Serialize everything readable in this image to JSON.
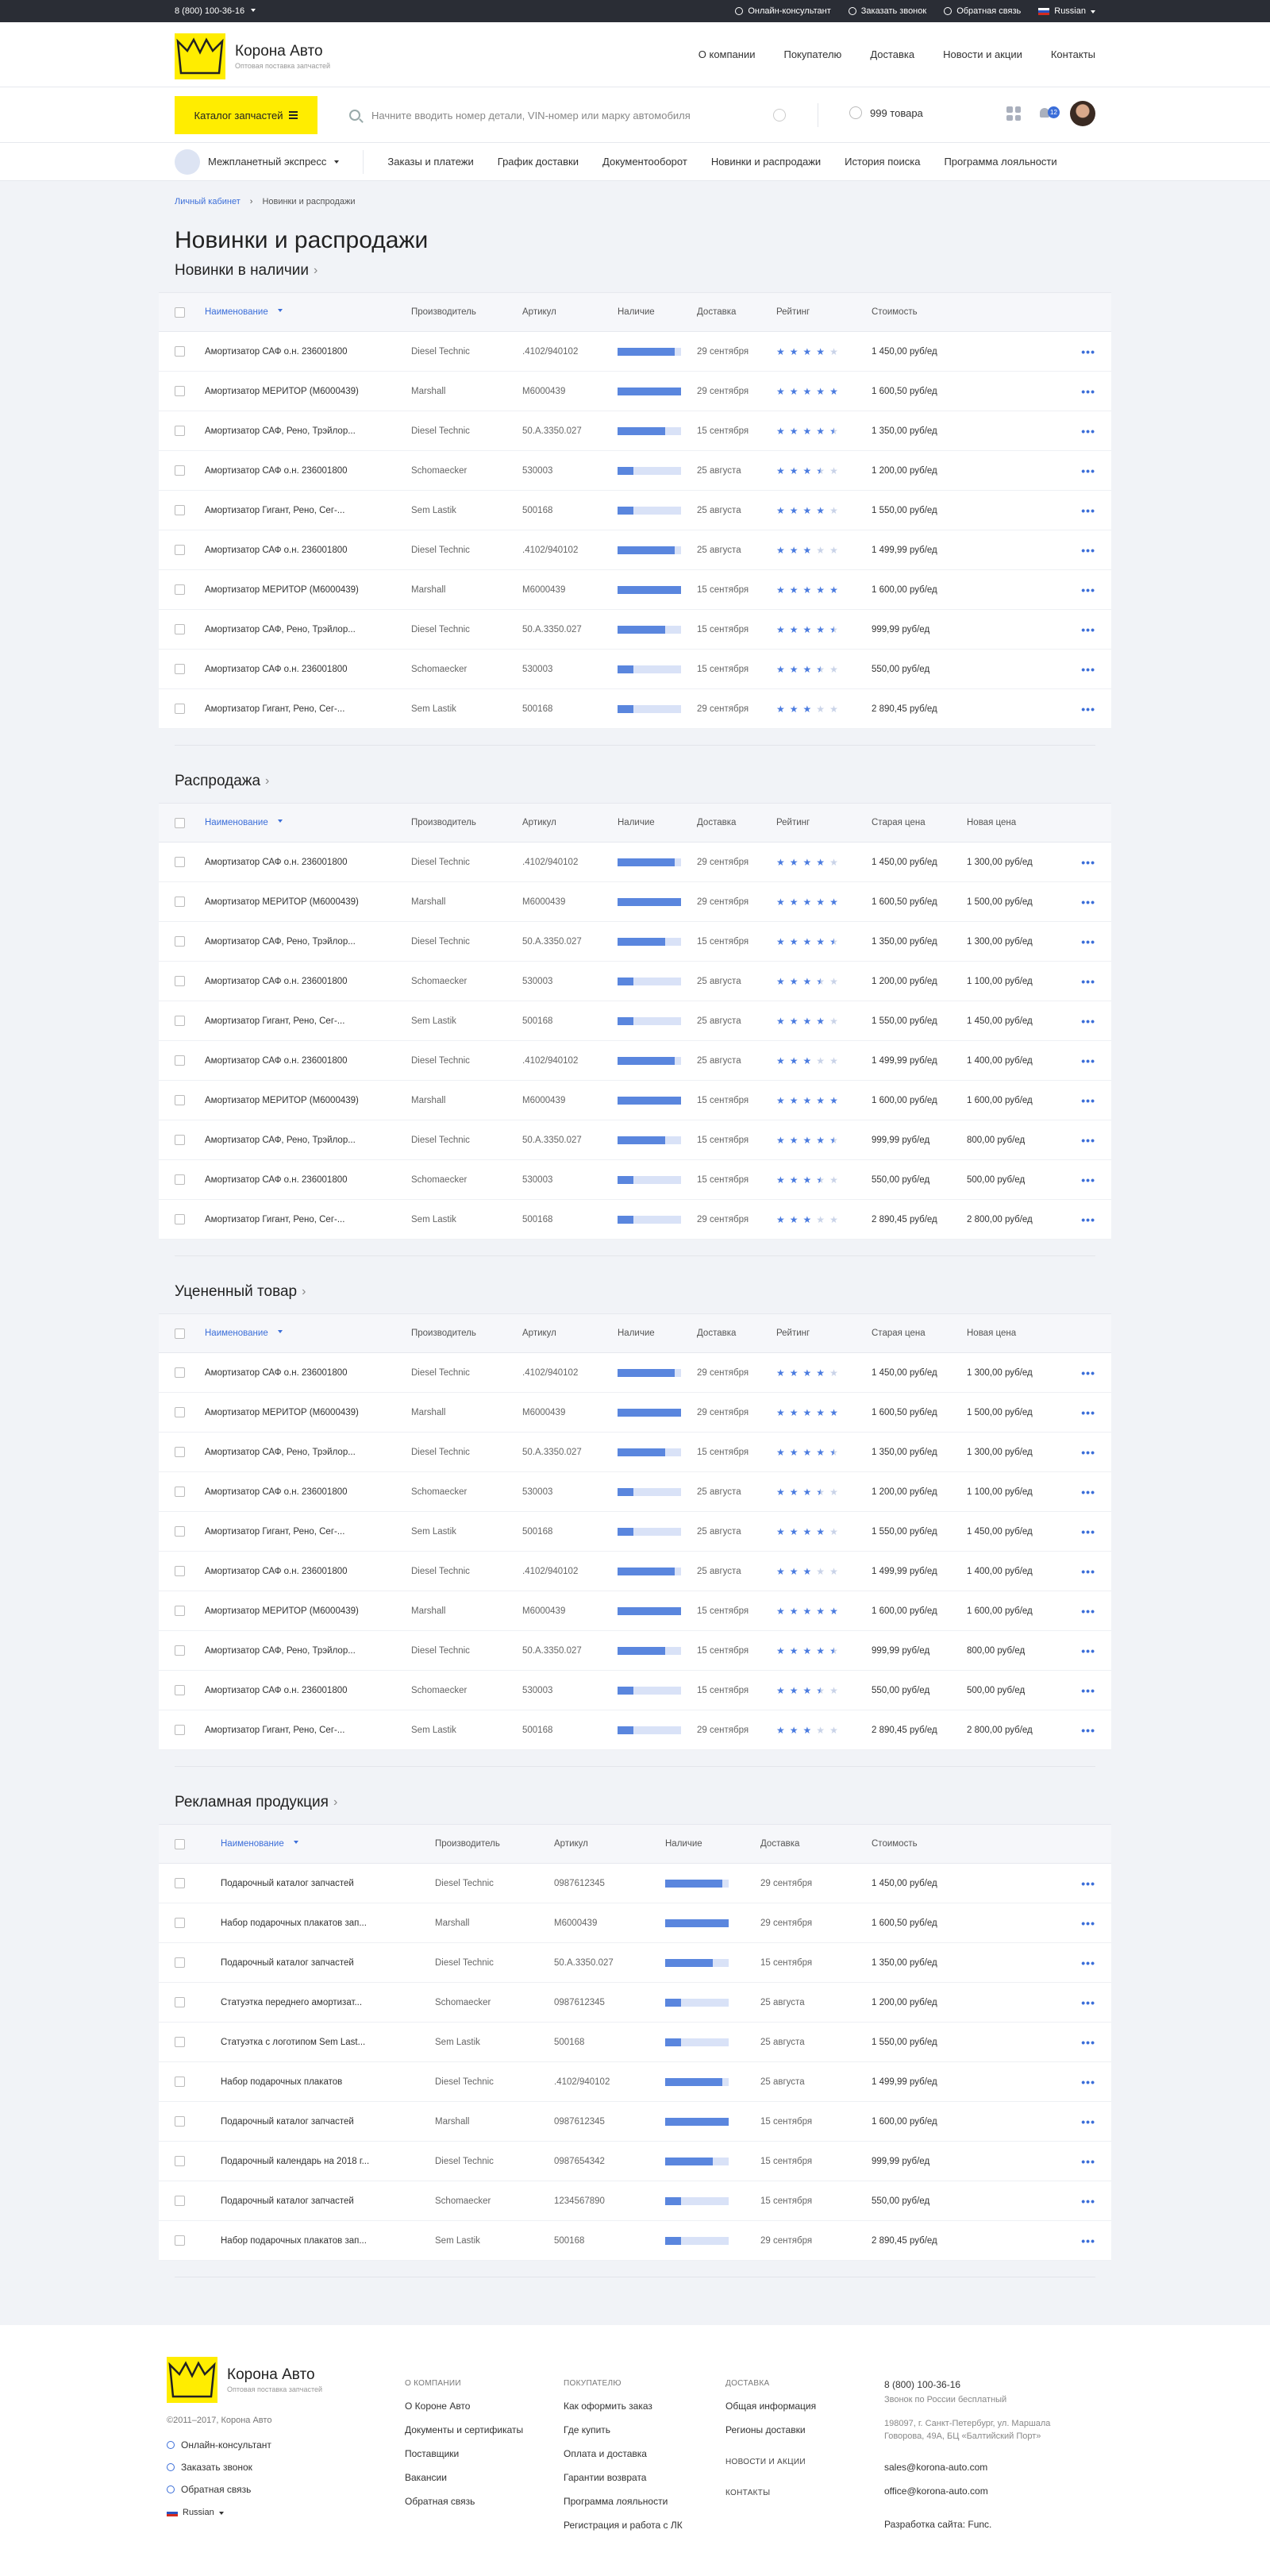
{
  "topbar": {
    "phone": "8 (800) 100-36-16",
    "links": [
      "Онлайн-консультант",
      "Заказать звонок",
      "Обратная связь"
    ],
    "lang": "Russian"
  },
  "header": {
    "logo_title": "Корона Авто",
    "logo_sub": "Оптовая поставка запчастей",
    "nav": [
      "О компании",
      "Покупателю",
      "Доставка",
      "Новости и акции",
      "Контакты"
    ]
  },
  "searchbar": {
    "catalog_btn": "Каталог запчастей",
    "placeholder": "Начните вводить номер детали, VIN-номер или марку автомобиля",
    "cart": "999 товара",
    "notifications": "12"
  },
  "subnav": {
    "items": [
      "Межпланетный экспресс",
      "Заказы и платежи",
      "График доставки",
      "Документооборот",
      "Новинки и распродажи",
      "История поиска",
      "Программа лояльности"
    ]
  },
  "breadcrumbs": [
    "Личный кабинет",
    "Новинки и распродажи"
  ],
  "page_title": "Новинки и распродажи",
  "sections": [
    {
      "title": "Новинки в наличии",
      "type": "rating",
      "cols": [
        "Наименование",
        "Производитель",
        "Артикул",
        "Наличие",
        "Доставка",
        "Рейтинг",
        "Стоимость"
      ],
      "rows": [
        [
          "Амортизатор САФ о.н. 236001800",
          "Diesel Technic",
          ".4102/940102",
          0.9,
          "29 сентября",
          4,
          "1 450,00 руб/ед"
        ],
        [
          "Амортизатор МЕРИТОР (M6000439)",
          "Marshall",
          "M6000439",
          1,
          "29 сентября",
          5,
          "1 600,50 руб/ед"
        ],
        [
          "Амортизатор САФ, Рено, Трэйлор...",
          "Diesel Technic",
          "50.A.3350.027",
          0.75,
          "15 сентября",
          4.5,
          "1 350,00 руб/ед"
        ],
        [
          "Амортизатор САФ о.н. 236001800",
          "Schomaecker",
          "530003",
          0.25,
          "25 августа",
          3.5,
          "1 200,00 руб/ед"
        ],
        [
          "Амортизатор Гигант, Рено, Сег-...",
          "Sem Lastik",
          "500168",
          0.25,
          "25 августа",
          4,
          "1 550,00 руб/ед"
        ],
        [
          "Амортизатор САФ о.н. 236001800",
          "Diesel Technic",
          ".4102/940102",
          0.9,
          "25 августа",
          3,
          "1 499,99 руб/ед"
        ],
        [
          "Амортизатор МЕРИТОР (M6000439)",
          "Marshall",
          "M6000439",
          1,
          "15 сентября",
          5,
          "1 600,00 руб/ед"
        ],
        [
          "Амортизатор САФ, Рено, Трэйлор...",
          "Diesel Technic",
          "50.A.3350.027",
          0.75,
          "15 сентября",
          4.5,
          "999,99 руб/ед"
        ],
        [
          "Амортизатор САФ о.н. 236001800",
          "Schomaecker",
          "530003",
          0.25,
          "15 сентября",
          3.5,
          "550,00 руб/ед"
        ],
        [
          "Амортизатор Гигант, Рено, Сег-...",
          "Sem Lastik",
          "500168",
          0.25,
          "29 сентября",
          3,
          "2 890,45 руб/ед"
        ]
      ]
    },
    {
      "title": "Распродажа",
      "type": "sale",
      "cols": [
        "Наименование",
        "Производитель",
        "Артикул",
        "Наличие",
        "Доставка",
        "Рейтинг",
        "Старая цена",
        "Новая цена"
      ],
      "rows": [
        [
          "Амортизатор САФ о.н. 236001800",
          "Diesel Technic",
          ".4102/940102",
          0.9,
          "29 сентября",
          4,
          "1 450,00 руб/ед",
          "1 300,00 руб/ед"
        ],
        [
          "Амортизатор МЕРИТОР (M6000439)",
          "Marshall",
          "M6000439",
          1,
          "29 сентября",
          5,
          "1 600,50 руб/ед",
          "1 500,00 руб/ед"
        ],
        [
          "Амортизатор САФ, Рено, Трэйлор...",
          "Diesel Technic",
          "50.A.3350.027",
          0.75,
          "15 сентября",
          4.5,
          "1 350,00 руб/ед",
          "1 300,00 руб/ед"
        ],
        [
          "Амортизатор САФ о.н. 236001800",
          "Schomaecker",
          "530003",
          0.25,
          "25 августа",
          3.5,
          "1 200,00 руб/ед",
          "1 100,00 руб/ед"
        ],
        [
          "Амортизатор Гигант, Рено, Сег-...",
          "Sem Lastik",
          "500168",
          0.25,
          "25 августа",
          4,
          "1 550,00 руб/ед",
          "1 450,00 руб/ед"
        ],
        [
          "Амортизатор САФ о.н. 236001800",
          "Diesel Technic",
          ".4102/940102",
          0.9,
          "25 августа",
          3,
          "1 499,99 руб/ед",
          "1 400,00 руб/ед"
        ],
        [
          "Амортизатор МЕРИТОР (M6000439)",
          "Marshall",
          "M6000439",
          1,
          "15 сентября",
          5,
          "1 600,00 руб/ед",
          "1 600,00 руб/ед"
        ],
        [
          "Амортизатор САФ, Рено, Трэйлор...",
          "Diesel Technic",
          "50.A.3350.027",
          0.75,
          "15 сентября",
          4.5,
          "999,99 руб/ед",
          "800,00 руб/ед"
        ],
        [
          "Амортизатор САФ о.н. 236001800",
          "Schomaecker",
          "530003",
          0.25,
          "15 сентября",
          3.5,
          "550,00 руб/ед",
          "500,00 руб/ед"
        ],
        [
          "Амортизатор Гигант, Рено, Сег-...",
          "Sem Lastik",
          "500168",
          0.25,
          "29 сентября",
          3,
          "2 890,45 руб/ед",
          "2 800,00 руб/ед"
        ]
      ]
    },
    {
      "title": "Уцененный товар",
      "type": "sale",
      "cols": [
        "Наименование",
        "Производитель",
        "Артикул",
        "Наличие",
        "Доставка",
        "Рейтинг",
        "Старая цена",
        "Новая цена"
      ],
      "rows": [
        [
          "Амортизатор САФ о.н. 236001800",
          "Diesel Technic",
          ".4102/940102",
          0.9,
          "29 сентября",
          4,
          "1 450,00 руб/ед",
          "1 300,00 руб/ед"
        ],
        [
          "Амортизатор МЕРИТОР (M6000439)",
          "Marshall",
          "M6000439",
          1,
          "29 сентября",
          5,
          "1 600,50 руб/ед",
          "1 500,00 руб/ед"
        ],
        [
          "Амортизатор САФ, Рено, Трэйлор...",
          "Diesel Technic",
          "50.A.3350.027",
          0.75,
          "15 сентября",
          4.5,
          "1 350,00 руб/ед",
          "1 300,00 руб/ед"
        ],
        [
          "Амортизатор САФ о.н. 236001800",
          "Schomaecker",
          "530003",
          0.25,
          "25 августа",
          3.5,
          "1 200,00 руб/ед",
          "1 100,00 руб/ед"
        ],
        [
          "Амортизатор Гигант, Рено, Сег-...",
          "Sem Lastik",
          "500168",
          0.25,
          "25 августа",
          4,
          "1 550,00 руб/ед",
          "1 450,00 руб/ед"
        ],
        [
          "Амортизатор САФ о.н. 236001800",
          "Diesel Technic",
          ".4102/940102",
          0.9,
          "25 августа",
          3,
          "1 499,99 руб/ед",
          "1 400,00 руб/ед"
        ],
        [
          "Амортизатор МЕРИТОР (M6000439)",
          "Marshall",
          "M6000439",
          1,
          "15 сентября",
          5,
          "1 600,00 руб/ед",
          "1 600,00 руб/ед"
        ],
        [
          "Амортизатор САФ, Рено, Трэйлор...",
          "Diesel Technic",
          "50.A.3350.027",
          0.75,
          "15 сентября",
          4.5,
          "999,99 руб/ед",
          "800,00 руб/ед"
        ],
        [
          "Амортизатор САФ о.н. 236001800",
          "Schomaecker",
          "530003",
          0.25,
          "15 сентября",
          3.5,
          "550,00 руб/ед",
          "500,00 руб/ед"
        ],
        [
          "Амортизатор Гигант, Рено, Сег-...",
          "Sem Lastik",
          "500168",
          0.25,
          "29 сентября",
          3,
          "2 890,45 руб/ед",
          "2 800,00 руб/ед"
        ]
      ]
    },
    {
      "title": "Рекламная продукция",
      "type": "promo",
      "cols": [
        "Наименование",
        "Производитель",
        "Артикул",
        "Наличие",
        "Доставка",
        "Стоимость"
      ],
      "rows": [
        [
          "Подарочный каталог запчастей",
          "Diesel Technic",
          "0987612345",
          0.9,
          "29 сентября",
          "1 450,00 руб/ед"
        ],
        [
          "Набор подарочных плакатов зап...",
          "Marshall",
          "M6000439",
          1,
          "29 сентября",
          "1 600,50 руб/ед"
        ],
        [
          "Подарочный каталог запчастей",
          "Diesel Technic",
          "50.A.3350.027",
          0.75,
          "15 сентября",
          "1 350,00 руб/ед"
        ],
        [
          "Статуэтка переднего амортизат...",
          "Schomaecker",
          "0987612345",
          0.25,
          "25 августа",
          "1 200,00 руб/ед"
        ],
        [
          "Статуэтка с логотипом Sem Last...",
          "Sem Lastik",
          "500168",
          0.25,
          "25 августа",
          "1 550,00 руб/ед"
        ],
        [
          "Набор подарочных плакатов",
          "Diesel Technic",
          ".4102/940102",
          0.9,
          "25 августа",
          "1 499,99 руб/ед"
        ],
        [
          "Подарочный каталог запчастей",
          "Marshall",
          "0987612345",
          1,
          "15 сентября",
          "1 600,00 руб/ед"
        ],
        [
          "Подарочный календарь на 2018 г...",
          "Diesel Technic",
          "0987654342",
          0.75,
          "15 сентября",
          "999,99 руб/ед"
        ],
        [
          "Подарочный каталог запчастей",
          "Schomaecker",
          "1234567890",
          0.25,
          "15 сентября",
          "550,00 руб/ед"
        ],
        [
          "Набор подарочных плакатов зап...",
          "Sem Lastik",
          "500168",
          0.25,
          "29 сентября",
          "2 890,45 руб/ед"
        ]
      ]
    }
  ],
  "footer": {
    "logo_title": "Корона Авто",
    "logo_sub": "Оптовая поставка запчастей",
    "copyright": "©2011–2017, Корона Авто",
    "links": [
      "Онлайн-консультант",
      "Заказать звонок",
      "Обратная связь"
    ],
    "lang": "Russian",
    "col1": {
      "head": "О КОМПАНИИ",
      "items": [
        "О Короне Авто",
        "Документы и сертификаты",
        "Поставщики",
        "Вакансии",
        "Обратная связь"
      ]
    },
    "col2": {
      "head": "ПОКУПАТЕЛЮ",
      "items": [
        "Как оформить заказ",
        "Где купить",
        "Оплата и доставка",
        "Гарантии возврата",
        "Программа лояльности",
        "Регистрация и работа с ЛК"
      ]
    },
    "col3": {
      "head": "ДОСТАВКА",
      "items": [
        "Общая информация",
        "Регионы доставки"
      ],
      "head2": "НОВОСТИ И АКЦИИ",
      "head3": "КОНТАКТЫ"
    },
    "contact": {
      "phone": "8 (800) 100-36-16",
      "phone_note": "Звонок по России бесплатный",
      "address": "198097, г. Санкт-Петербург, ул. Маршала Говорова, 49А, БЦ «Балтийский Порт»",
      "email1": "sales@korona-auto.com",
      "email2": "office@korona-auto.com",
      "dev": "Разработка сайта: Func."
    }
  },
  "colors": {
    "accent": "#3b6ed9",
    "brand_yellow": "#ffed00",
    "topbar": "#2a2d35"
  }
}
